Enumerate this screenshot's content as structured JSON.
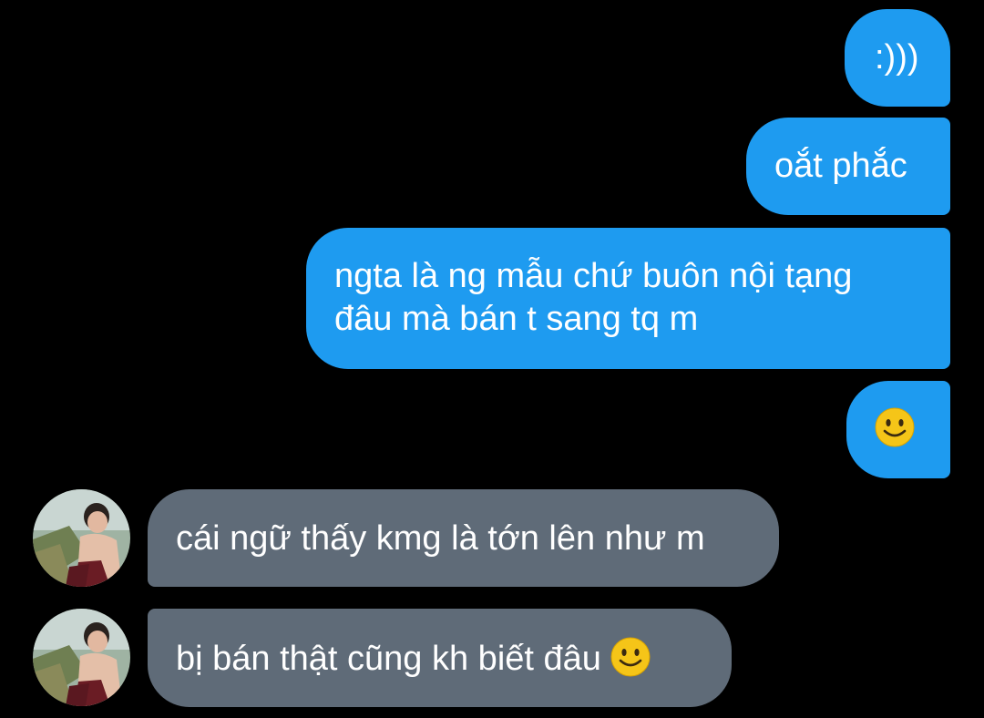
{
  "conversation": {
    "sent": [
      {
        "text": ":)))"
      },
      {
        "text": "oắt phắc"
      },
      {
        "text": "ngta là ng mẫu chứ buôn nội tạng đâu mà bán t sang tq m"
      },
      {
        "text": "",
        "emoji": "slightly-smiling-face-icon"
      }
    ],
    "received": [
      {
        "text": "cái ngữ thấy kmg là tớn lên như m"
      },
      {
        "text": "bị bán thật cũng kh biết đâu",
        "emoji": "slightly-smiling-face-icon"
      }
    ]
  },
  "colors": {
    "background": "#000000",
    "sent_bubble": "#1e9bf0",
    "received_bubble": "#5f6b78",
    "text": "#ffffff",
    "emoji_yellow": "#f5c518"
  }
}
